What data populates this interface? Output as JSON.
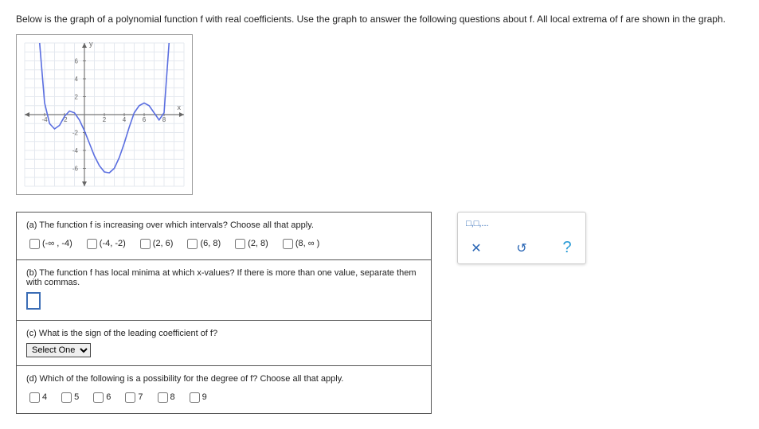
{
  "prompt": "Below is the graph of a polynomial function f with real coefficients. Use the graph to answer the following questions about f. All local extrema of f are shown in the graph.",
  "chart_data": {
    "type": "line",
    "xlabel": "x",
    "ylabel": "y",
    "xlim": [
      -6,
      10
    ],
    "ylim": [
      -8,
      8
    ],
    "x_ticks": [
      -4,
      -2,
      2,
      4,
      6,
      8
    ],
    "y_ticks": [
      -6,
      -4,
      -2,
      2,
      4,
      6
    ],
    "x": [
      -4.5,
      -4,
      -3.5,
      -3,
      -2.5,
      -2,
      -1.5,
      -1,
      -0.5,
      0,
      0.5,
      1,
      1.5,
      2,
      2.5,
      3,
      3.5,
      4,
      4.5,
      5,
      5.5,
      6,
      6.5,
      7,
      7.5,
      8,
      8.5
    ],
    "y": [
      8,
      1.3,
      -1,
      -1.6,
      -1.2,
      -0.2,
      0.4,
      0.2,
      -0.6,
      -1.8,
      -3.2,
      -4.6,
      -5.7,
      -6.4,
      -6.5,
      -6.0,
      -4.8,
      -3.2,
      -1.4,
      0.2,
      1.0,
      1.3,
      1.0,
      0.2,
      -0.6,
      0.2,
      8
    ],
    "title": ""
  },
  "qa": {
    "a_text": "(a) The function f is increasing over which intervals? Choose all that apply.",
    "a_opts": [
      "(-∞ , -4)",
      "(-4, -2)",
      "(2, 6)",
      "(6, 8)",
      "(2, 8)",
      "(8, ∞ )"
    ],
    "b_text": "(b) The function f has local minima at which x-values? If there is more than one value, separate them with commas.",
    "c_text": "(c) What is the sign of the leading coefficient of f?",
    "c_placeholder": "Select One",
    "d_text": "(d) Which of the following is a possibility for the degree of f? Choose all that apply.",
    "d_opts": [
      "4",
      "5",
      "6",
      "7",
      "8",
      "9"
    ]
  },
  "side": {
    "hint": "□,□,..."
  }
}
